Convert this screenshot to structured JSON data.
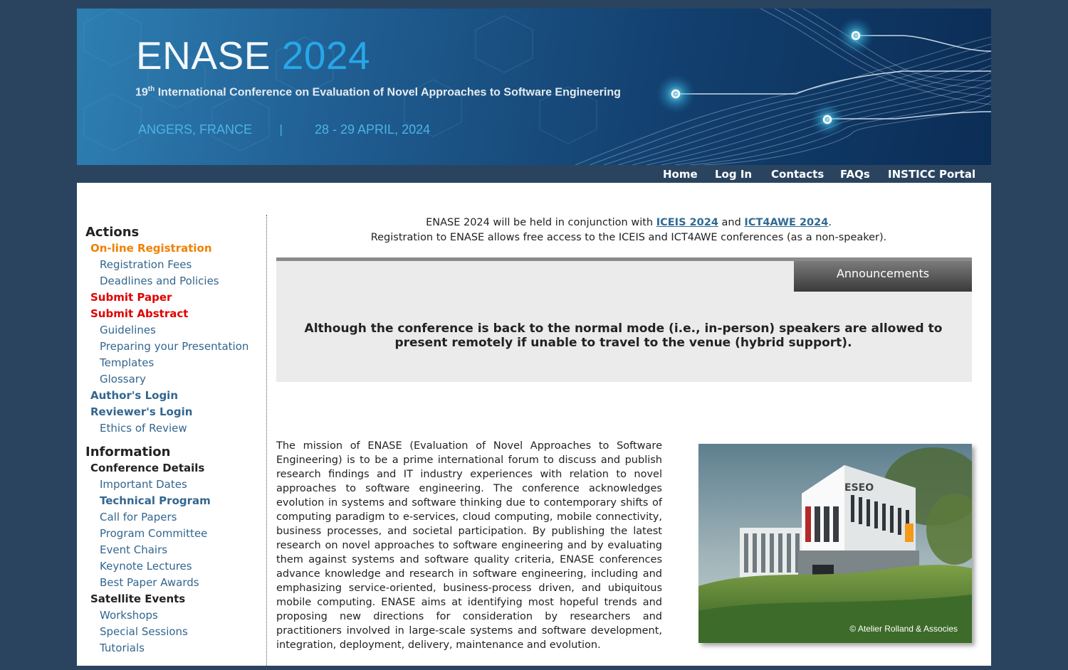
{
  "banner": {
    "title_prefix": "ENASE",
    "title_year": "2024",
    "ordinal": "19",
    "ordinal_suffix": "th",
    "subtitle": "International Conference on Evaluation of Novel Approaches to Software Engineering",
    "location": "ANGERS, FRANCE",
    "separator": "|",
    "dates": "28 - 29 APRIL, 2024"
  },
  "topnav": [
    "Home",
    "Log In",
    "Contacts",
    "FAQs",
    "INSTICC Portal"
  ],
  "sidebar": {
    "actions_heading": "Actions",
    "actions": [
      {
        "label": "On-line Registration",
        "level": 1,
        "style": "orange"
      },
      {
        "label": "Registration Fees",
        "level": 2
      },
      {
        "label": "Deadlines and Policies",
        "level": 2
      },
      {
        "label": "Submit Paper",
        "level": 1,
        "style": "red"
      },
      {
        "label": "Submit Abstract",
        "level": 1,
        "style": "red"
      },
      {
        "label": "Guidelines",
        "level": 2
      },
      {
        "label": "Preparing your Presentation",
        "level": 2
      },
      {
        "label": "Templates",
        "level": 2
      },
      {
        "label": "Glossary",
        "level": 2
      },
      {
        "label": "Author's Login",
        "level": 1,
        "style": "blue"
      },
      {
        "label": "Reviewer's Login",
        "level": 1,
        "style": "blue"
      },
      {
        "label": "Ethics of Review",
        "level": 2
      }
    ],
    "information_heading": "Information",
    "information": [
      {
        "label": "Conference Details",
        "level": 1,
        "style": "dark"
      },
      {
        "label": "Important Dates",
        "level": 2
      },
      {
        "label": "Technical Program",
        "level": 2,
        "bold": true
      },
      {
        "label": "Call for Papers",
        "level": 2
      },
      {
        "label": "Program Committee",
        "level": 2
      },
      {
        "label": "Event Chairs",
        "level": 2
      },
      {
        "label": "Keynote Lectures",
        "level": 2
      },
      {
        "label": "Best Paper Awards",
        "level": 2
      },
      {
        "label": "Satellite Events",
        "level": 1,
        "style": "dark"
      },
      {
        "label": "Workshops",
        "level": 2
      },
      {
        "label": "Special Sessions",
        "level": 2
      },
      {
        "label": "Tutorials",
        "level": 2
      }
    ]
  },
  "intro": {
    "line1_prefix": "ENASE 2024 will be held in conjunction with ",
    "link1": "ICEIS 2024",
    "and": " and ",
    "link2": "ICT4AWE 2024",
    "line1_suffix": ".",
    "line2": "Registration to ENASE allows free access to the ICEIS and ICT4AWE conferences (as a non-speaker)."
  },
  "announcements": {
    "tab_label": "Announcements",
    "text": "Although the conference is back to the normal mode (i.e., in-person) speakers are allowed to present remotely if unable to travel to the venue (hybrid support)."
  },
  "mission": "The mission of ENASE (Evaluation of Novel Approaches to Software Engineering) is to be a prime international forum to discuss and publish research findings and IT industry experiences with relation to novel approaches to software engineering. The conference acknowledges evolution in systems and software thinking due to contemporary shifts of computing paradigm to e-services, cloud computing, mobile connectivity, business processes, and societal participation. By publishing the latest research on novel approaches to software engineering and by evaluating them against systems and software quality criteria, ENASE conferences advance knowledge and research in software engineering, including and emphasizing service-oriented, business-process driven, and ubiquitous mobile computing. ENASE aims at identifying most hopeful trends and proposing new directions for consideration by researchers and practitioners involved in large-scale systems and software development, integration, deployment, delivery, maintenance and evolution.",
  "photo": {
    "credit": "© Atelier Rolland & Associes",
    "sign": "ESEO"
  },
  "colors": {
    "page_bg": "#2a4460",
    "link_blue": "#33668f",
    "orange": "#f08000",
    "red": "#e00000",
    "year_blue": "#27a7e8"
  }
}
